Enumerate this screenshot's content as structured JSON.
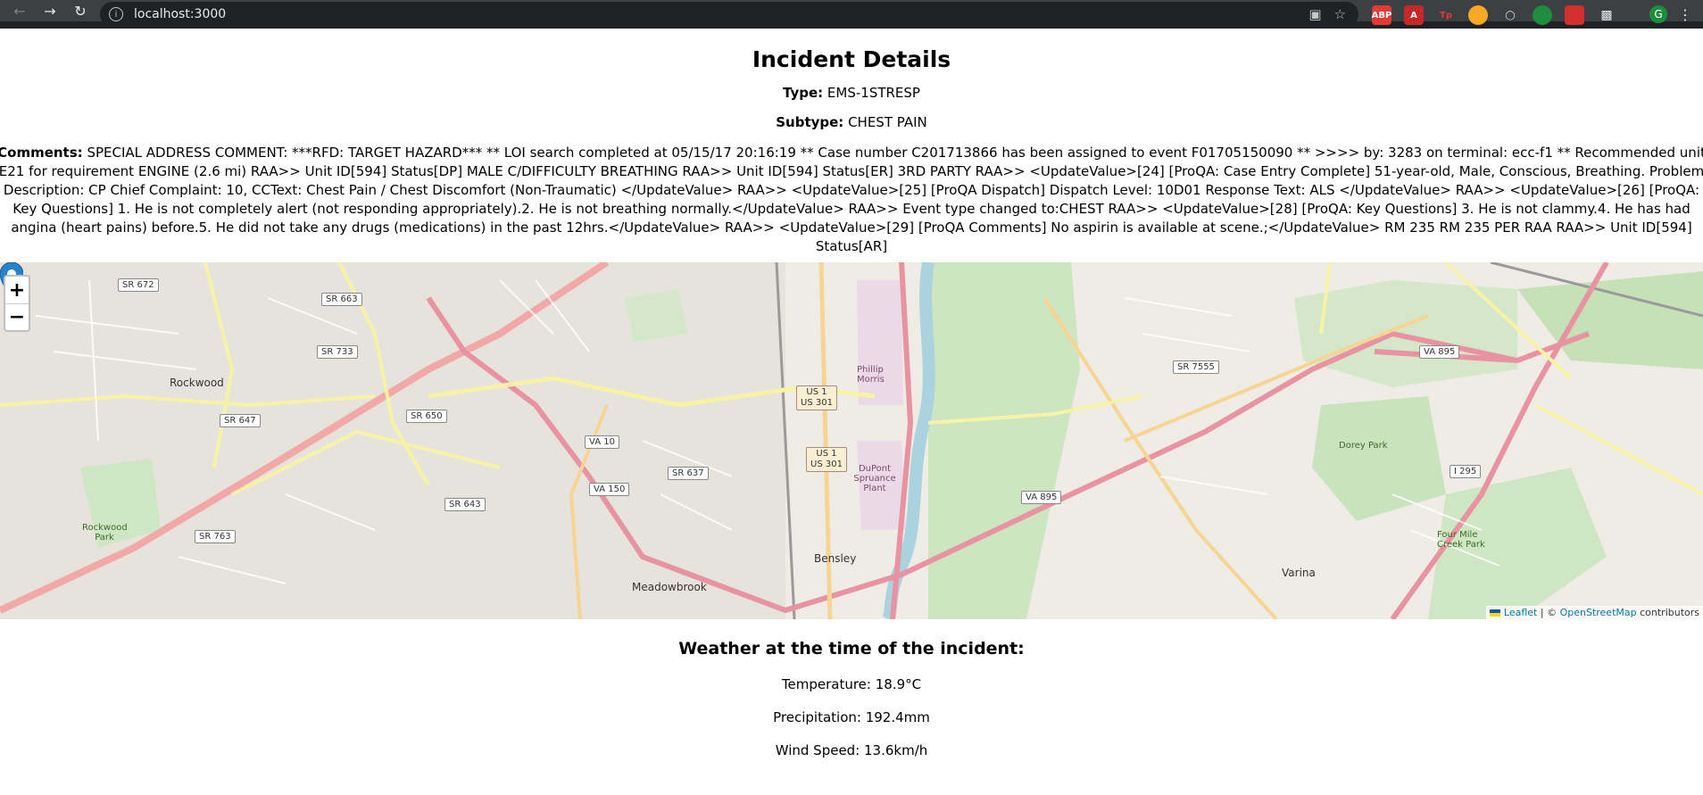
{
  "browser": {
    "url": "localhost:3000",
    "avatar_letter": "G"
  },
  "page": {
    "title": "Incident Details",
    "type_label": "Type:",
    "type_value": "EMS-1STRESP",
    "subtype_label": "Subtype:",
    "subtype_value": "CHEST PAIN",
    "comments_label": "Comments:",
    "comments_value": "SPECIAL ADDRESS COMMENT: ***RFD: TARGET HAZARD*** ** LOI search completed at 05/15/17 20:16:19 ** Case number C201713866 has been assigned to event F01705150090 ** >>>> by: 3283 on terminal: ecc-f1 ** Recommended unit E21 for requirement ENGINE (2.6 mi) RAA>> Unit ID[594] Status[DP] MALE C/DIFFICULTY BREATHING RAA>> Unit ID[594] Status[ER] 3RD PARTY RAA>> <UpdateValue>[24] [ProQA: Case Entry Complete] 51-year-old, Male, Conscious, Breathing. Problem Description: CP Chief Complaint: 10, CCText: Chest Pain / Chest Discomfort (Non-Traumatic) </UpdateValue> RAA>> <UpdateValue>[25] [ProQA Dispatch] Dispatch Level: 10D01 Response Text: ALS </UpdateValue> RAA>> <UpdateValue>[26] [ProQA: Key Questions] 1. He is not completely alert (not responding appropriately).2. He is not breathing normally.</UpdateValue> RAA>> Event type changed to:CHEST RAA>> <UpdateValue>[28] [ProQA: Key Questions] 3. He is not clammy.4. He has had angina (heart pains) before.5. He did not take any drugs (medications) in the past 12hrs.</UpdateValue> RAA>> <UpdateValue>[29] [ProQA Comments] No aspirin is available at scene.;</UpdateValue> RM 235 RM 235 PER RAA RAA>> Unit ID[594] Status[AR]"
  },
  "map": {
    "zoom_in": "+",
    "zoom_out": "−",
    "attribution_leaflet": "Leaflet",
    "attribution_sep": " | © ",
    "attribution_osm": "OpenStreetMap",
    "attribution_tail": " contributors",
    "labels": {
      "rockwood": "Rockwood",
      "rockwood_park": "Rockwood Park",
      "meadowbrook": "Meadowbrook",
      "bensley": "Bensley",
      "varina": "Varina",
      "dorey_park": "Dorey Park",
      "philip_morris": "Phillip Morris",
      "dupont": "DuPont Spruance Plant",
      "four_mile": "Four Mile Creek Park"
    },
    "shields": {
      "sr672": "SR 672",
      "sr663": "SR 663",
      "sr733": "SR 733",
      "sr647": "SR 647",
      "sr650": "SR 650",
      "va10": "VA 10",
      "va150": "VA 150",
      "sr637": "SR 637",
      "sr643": "SR 643",
      "sr763": "SR 763",
      "us1a": "US 1 US 301",
      "us1b": "US 1 US 301",
      "va895a": "VA 895",
      "va895b": "VA 895",
      "sr7555": "SR 7555",
      "i295": "I 295"
    }
  },
  "weather": {
    "heading": "Weather at the time of the incident:",
    "temperature": "Temperature: 18.9°C",
    "precipitation": "Precipitation: 192.4mm",
    "wind": "Wind Speed: 13.6km/h"
  }
}
